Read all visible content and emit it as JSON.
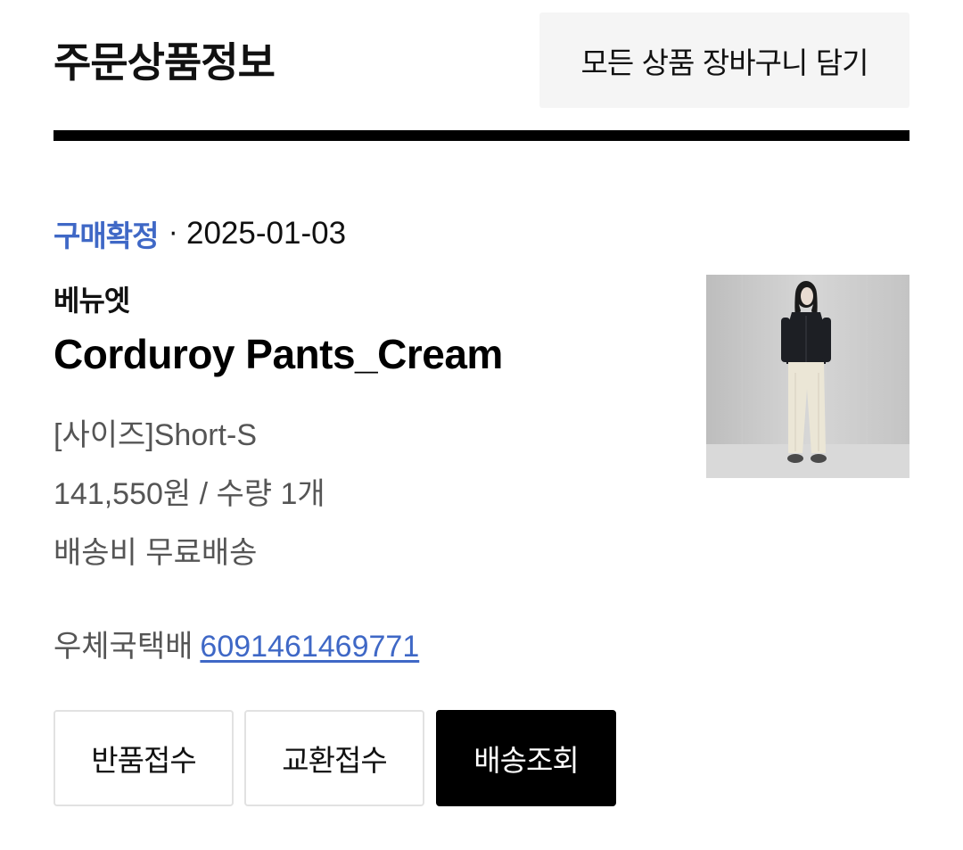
{
  "header": {
    "title": "주문상품정보",
    "cart_all_button": "모든 상품 장바구니 담기"
  },
  "order": {
    "status": "구매확정",
    "separator": "·",
    "date": "2025-01-03",
    "brand": "베뉴엣",
    "product_name": "Corduroy Pants_Cream",
    "option": "[사이즈]Short-S",
    "price_quantity": "141,550원 / 수량 1개",
    "shipping_fee": "배송비 무료배송",
    "courier": "우체국택배",
    "tracking_number": "6091461469771"
  },
  "actions": {
    "return": "반품접수",
    "exchange": "교환접수",
    "track": "배송조회"
  },
  "colors": {
    "accent_blue": "#3f68c6",
    "text_primary": "#111111",
    "text_secondary": "#555555",
    "button_bg_light": "#f5f5f5",
    "button_dark": "#000000"
  }
}
